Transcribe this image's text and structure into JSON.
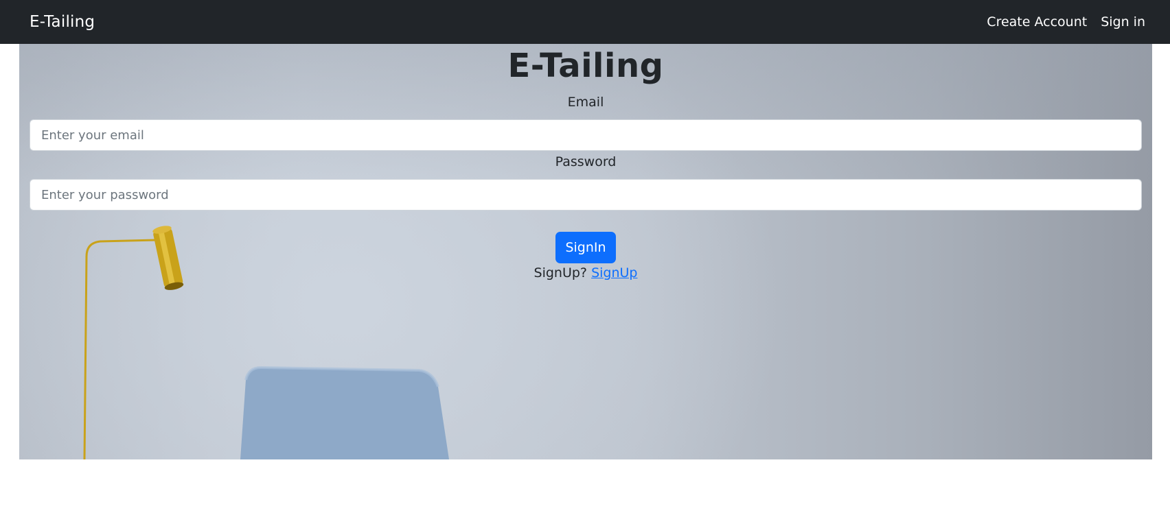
{
  "navbar": {
    "brand": "E-Tailing",
    "links": [
      {
        "label": "Create Account"
      },
      {
        "label": "Sign in"
      }
    ]
  },
  "form": {
    "title": "E-Tailing",
    "email": {
      "label": "Email",
      "placeholder": "Enter your email",
      "value": ""
    },
    "password": {
      "label": "Password",
      "placeholder": "Enter your password",
      "value": ""
    },
    "submit_label": "SignIn",
    "signup_prompt": "SignUp?",
    "signup_link": "SignUp"
  },
  "colors": {
    "navbar_bg": "#212529",
    "primary": "#0d6efd",
    "text": "#212529",
    "lamp_gold": "#c9a21a",
    "chair_blue": "#8ea9c8"
  }
}
